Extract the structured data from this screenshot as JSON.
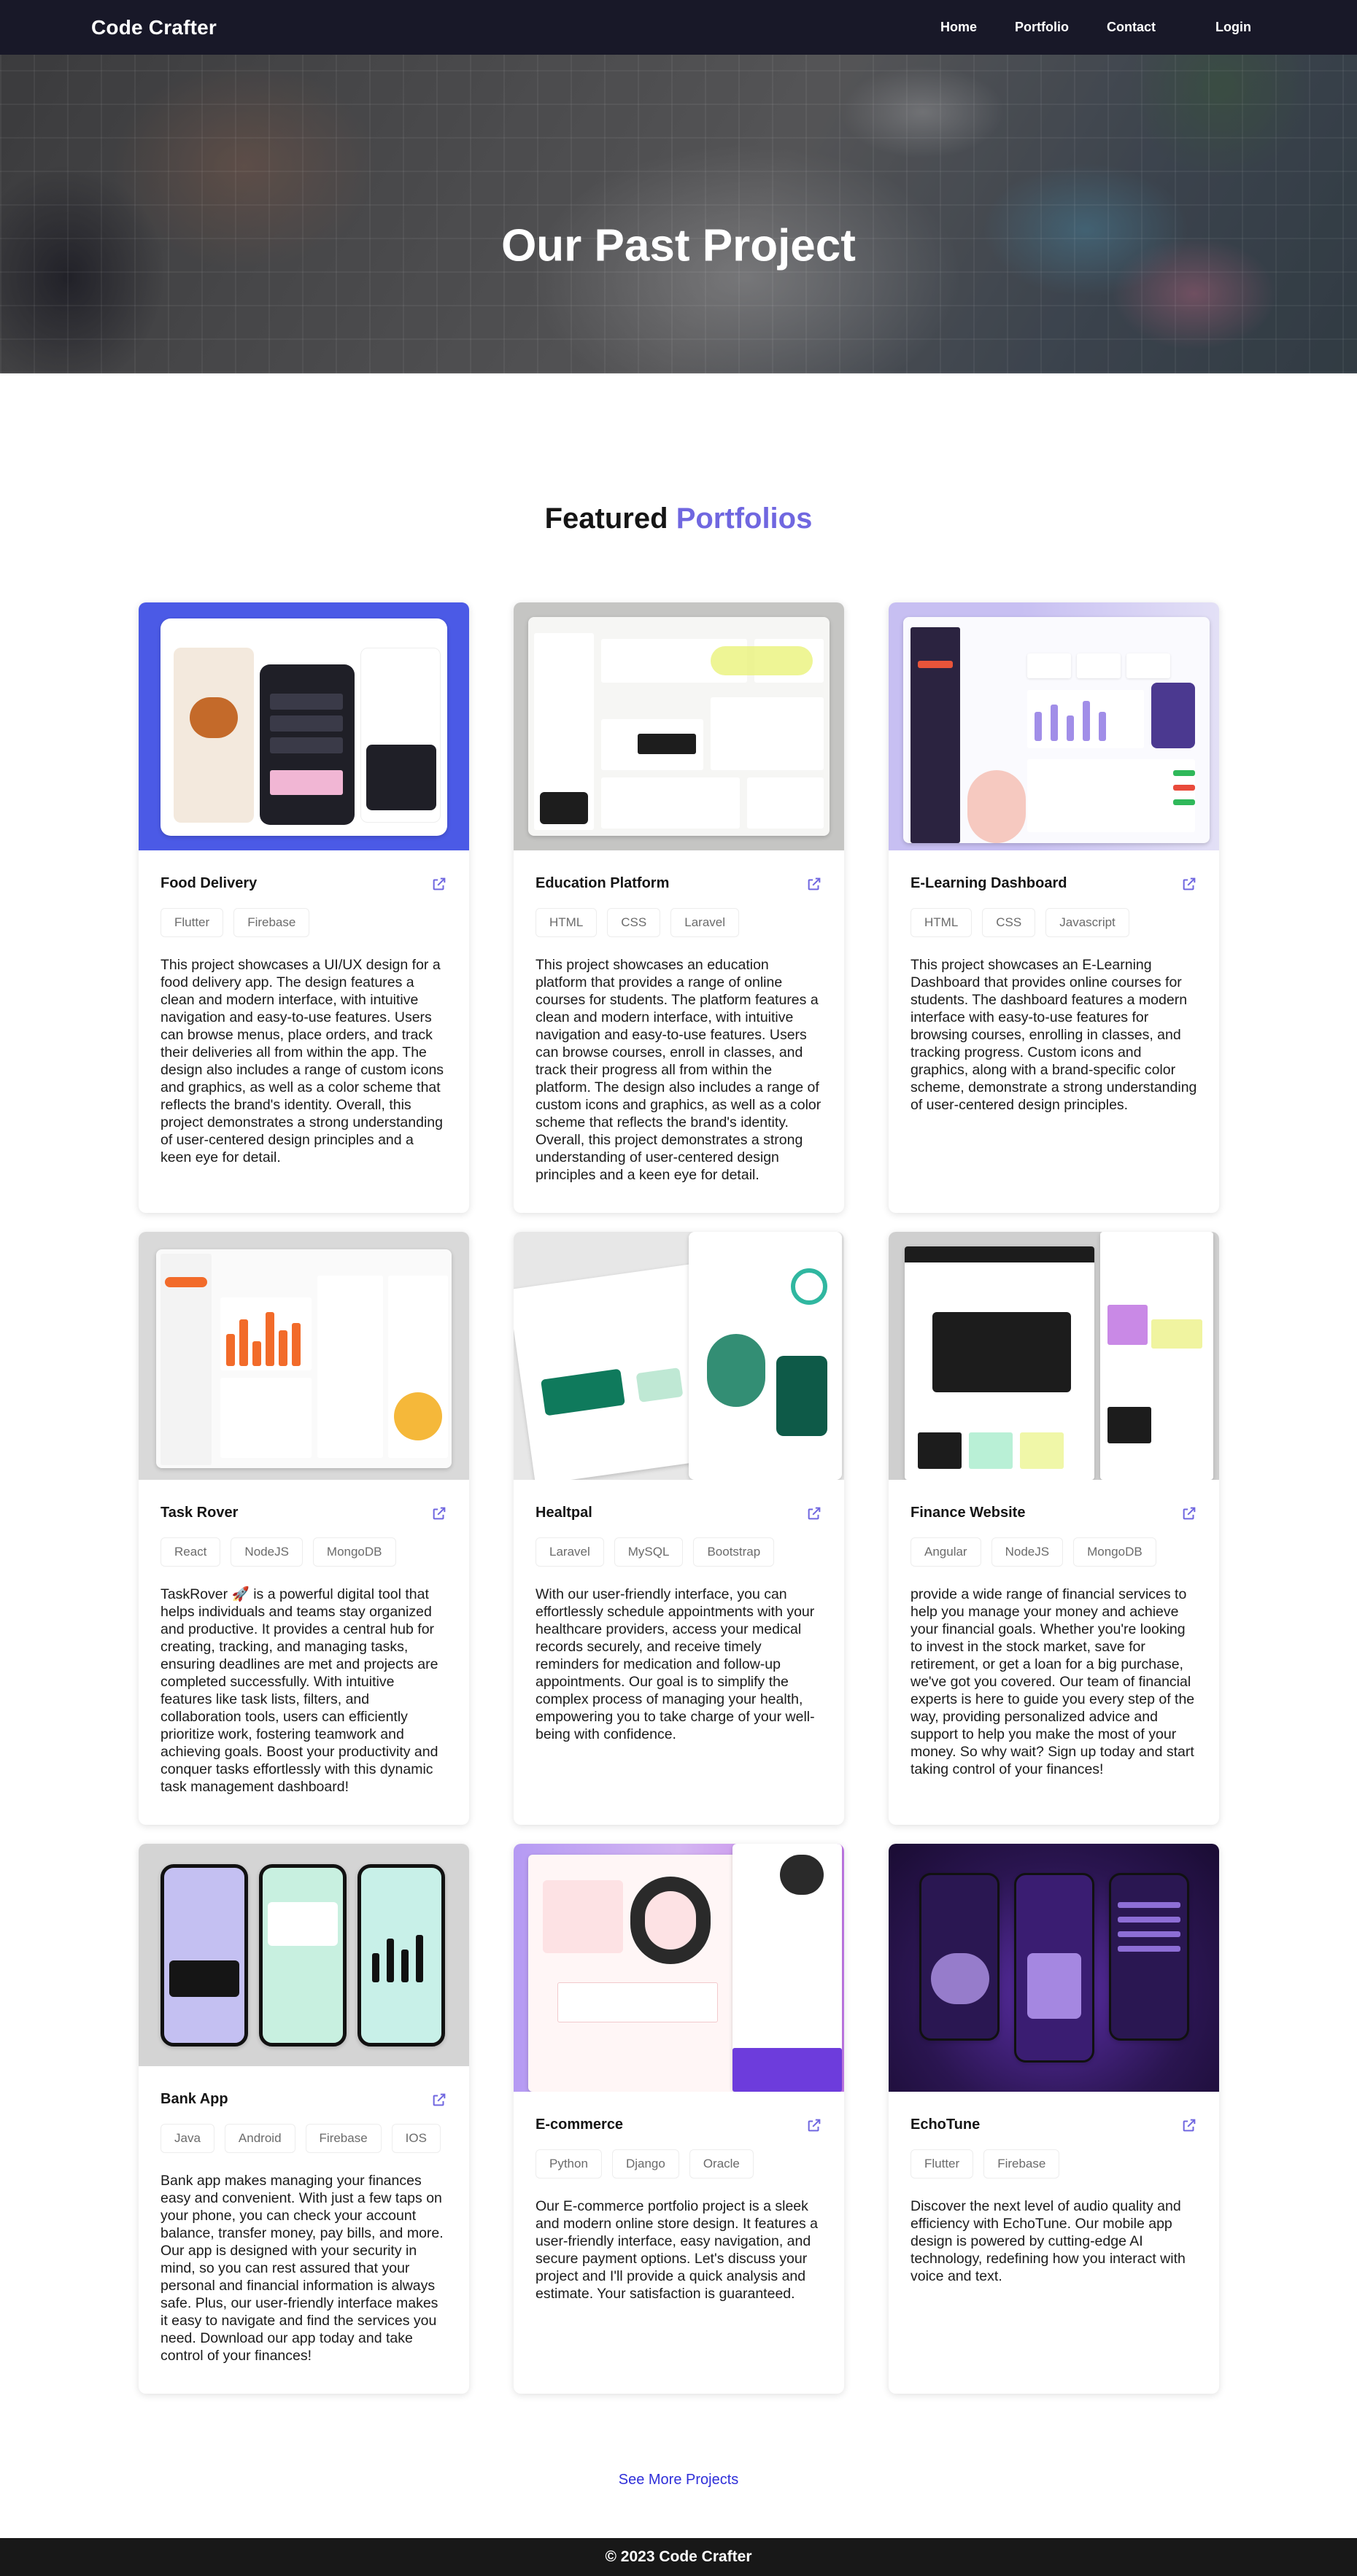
{
  "nav": {
    "brand": "Code Crafter",
    "links": [
      "Home",
      "Portfolio",
      "Contact"
    ],
    "login": "Login"
  },
  "hero": {
    "title": "Our Past Project"
  },
  "section": {
    "title_main": "Featured",
    "title_accent": "Portfolios",
    "accent_color": "#7067e0"
  },
  "projects": [
    {
      "title": "Food Delivery",
      "tags": [
        "Flutter",
        "Firebase"
      ],
      "description": "This project showcases a UI/UX design for a food delivery app. The design features a clean and modern interface, with intuitive navigation and easy-to-use features. Users can browse menus, place orders, and track their deliveries all from within the app. The design also includes a range of custom icons and graphics, as well as a color scheme that reflects the brand's identity. Overall, this project demonstrates a strong understanding of user-centered design principles and a keen eye for detail."
    },
    {
      "title": "Education Platform",
      "tags": [
        "HTML",
        "CSS",
        "Laravel"
      ],
      "description": "This project showcases an education platform that provides a range of online courses for students. The platform features a clean and modern interface, with intuitive navigation and easy-to-use features. Users can browse courses, enroll in classes, and track their progress all from within the platform. The design also includes a range of custom icons and graphics, as well as a color scheme that reflects the brand's identity. Overall, this project demonstrates a strong understanding of user-centered design principles and a keen eye for detail."
    },
    {
      "title": "E-Learning Dashboard",
      "tags": [
        "HTML",
        "CSS",
        "Javascript"
      ],
      "description": "This project showcases an E-Learning Dashboard that provides online courses for students. The dashboard features a modern interface with easy-to-use features for browsing courses, enrolling in classes, and tracking progress. Custom icons and graphics, along with a brand-specific color scheme, demonstrate a strong understanding of user-centered design principles."
    },
    {
      "title": "Task Rover",
      "tags": [
        "React",
        "NodeJS",
        "MongoDB"
      ],
      "description": "TaskRover 🚀 is a powerful digital tool that helps individuals and teams stay organized and productive. It provides a central hub for creating, tracking, and managing tasks, ensuring deadlines are met and projects are completed successfully. With intuitive features like task lists, filters, and collaboration tools, users can efficiently prioritize work, fostering teamwork and achieving goals. Boost your productivity and conquer tasks effortlessly with this dynamic task management dashboard!"
    },
    {
      "title": "Healtpal",
      "tags": [
        "Laravel",
        "MySQL",
        "Bootstrap"
      ],
      "description": "With our user-friendly interface, you can effortlessly schedule appointments with your healthcare providers, access your medical records securely, and receive timely reminders for medication and follow-up appointments. Our goal is to simplify the complex process of managing your health, empowering you to take charge of your well-being with confidence."
    },
    {
      "title": "Finance Website",
      "tags": [
        "Angular",
        "NodeJS",
        "MongoDB"
      ],
      "description": "provide a wide range of financial services to help you manage your money and achieve your financial goals. Whether you're looking to invest in the stock market, save for retirement, or get a loan for a big purchase, we've got you covered. Our team of financial experts is here to guide you every step of the way, providing personalized advice and support to help you make the most of your money. So why wait? Sign up today and start taking control of your finances!"
    },
    {
      "title": "Bank App",
      "tags": [
        "Java",
        "Android",
        "Firebase",
        "IOS"
      ],
      "description": "Bank app makes managing your finances easy and convenient. With just a few taps on your phone, you can check your account balance, transfer money, pay bills, and more. Our app is designed with your security in mind, so you can rest assured that your personal and financial information is always safe. Plus, our user-friendly interface makes it easy to navigate and find the services you need. Download our app today and take control of your finances!"
    },
    {
      "title": "E-commerce",
      "tags": [
        "Python",
        "Django",
        "Oracle"
      ],
      "description": "Our E-commerce portfolio project is a sleek and modern online store design. It features a user-friendly interface, easy navigation, and secure payment options. Let's discuss your project and I'll provide a quick analysis and estimate. Your satisfaction is guaranteed."
    },
    {
      "title": "EchoTune",
      "tags": [
        "Flutter",
        "Firebase"
      ],
      "description": "Discover the next level of audio quality and efficiency with EchoTune. Our mobile app design is powered by cutting-edge AI technology, redefining how you interact with voice and text."
    }
  ],
  "see_more": "See More Projects",
  "footer": "© 2023 Code Crafter"
}
